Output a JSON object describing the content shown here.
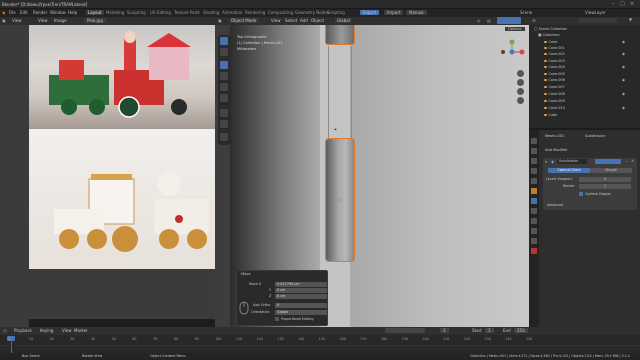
{
  "window": {
    "title": "Blender* [D:\\Kewu\\Урок\\Tren\\TRAIN.blend]"
  },
  "menu": {
    "items": [
      "File",
      "Edit",
      "Render",
      "Window",
      "Help"
    ]
  },
  "workspaces": [
    "Layout",
    "Modeling",
    "Sculpting",
    "UV Editing",
    "Texture Paint",
    "Shading",
    "Animation",
    "Rendering",
    "Compositing",
    "Geometry Nodes",
    "Scripting"
  ],
  "active_workspace": "Layout",
  "scene": {
    "label": "Scene",
    "view_layer": "ViewLayer"
  },
  "image_editor": {
    "menu": [
      "View",
      "View",
      "Image"
    ],
    "image_name": "Pink.jpg"
  },
  "viewport": {
    "mode": "Object Mode",
    "menus": [
      "View",
      "Select",
      "Add",
      "Object"
    ],
    "orientation": "Global",
    "overlay_lines": [
      "Top Orthographic",
      "(1) Collection | Meshs.001",
      "Millimeters"
    ],
    "options_label": "Options"
  },
  "header_buttons": [
    "Export",
    "Import",
    "Manual"
  ],
  "operator_panel": {
    "title": "Move",
    "rows": [
      {
        "label": "Move X",
        "value": "0.517794 cm"
      },
      {
        "label": "Y",
        "value": "0 cm"
      },
      {
        "label": "Z",
        "value": "0 cm"
      }
    ],
    "axis_ortho_label": "Axis Ortho",
    "axis_ortho_value": "X",
    "orientation_label": "Orientation",
    "orientation_value": "Global",
    "proportional_label": "Proportional Editing"
  },
  "outliner": {
    "root": "Scene Collection",
    "collection": "Collection",
    "items": [
      "Cone",
      "Cone.001",
      "Cone.002",
      "Cone.003",
      "Cone.004",
      "Cone.005",
      "Cone.006",
      "Cone.007",
      "Cone.008",
      "Cone.009",
      "Cone.010",
      "Cube"
    ]
  },
  "properties": {
    "object_name": "Meshs.001",
    "modifier_type": "Subdivision",
    "add_modifier": "Add Modifier",
    "modifier_name": "Subdivision",
    "tabs": [
      "Catmull-Clark",
      "Simple"
    ],
    "levels_viewport_label": "Levels Viewport",
    "levels_viewport_value": "2",
    "render_label": "Render",
    "render_value": "2",
    "optimal_display": "Optimal Display",
    "advanced": "Advanced"
  },
  "timeline": {
    "menus": [
      "Playback",
      "Keying",
      "View",
      "Marker"
    ],
    "current_frame": "1",
    "start_label": "Start",
    "start_value": "1",
    "end_label": "End",
    "end_value": "250",
    "ticks": [
      "0",
      "10",
      "20",
      "30",
      "40",
      "50",
      "60",
      "70",
      "80",
      "90",
      "100",
      "110",
      "120",
      "130",
      "140",
      "150",
      "160",
      "170",
      "180",
      "190",
      "200",
      "210",
      "220",
      "230",
      "240",
      "250"
    ]
  },
  "status_bar": {
    "left": [
      "Box Select",
      "Rotate View",
      "Object Context Menu"
    ],
    "right": "Collection | Meshs.001 | Verts:4,571 | Faces:4,560 | Tris:9,120 | Objects:1/24 | Mem: 29.4 MiB | 3.2.0"
  },
  "colors": {
    "accent": "#4772b3",
    "selection": "#e07a2a",
    "object": "#e79e3e"
  }
}
